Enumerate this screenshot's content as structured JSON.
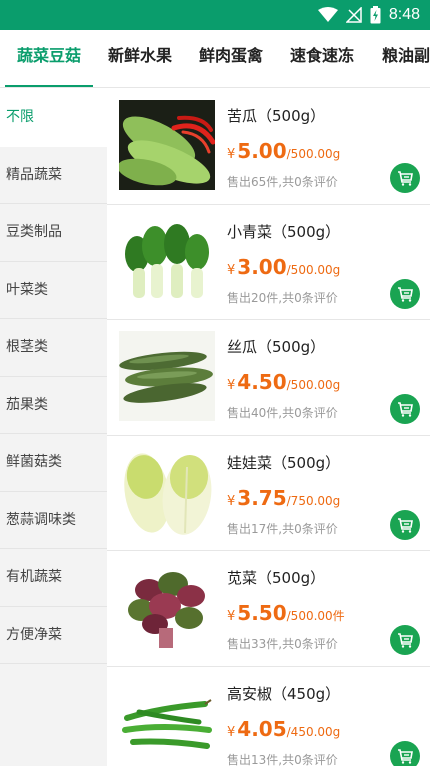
{
  "status_bar": {
    "time": "8:48"
  },
  "tabs": [
    {
      "label": "蔬菜豆菇"
    },
    {
      "label": "新鲜水果"
    },
    {
      "label": "鲜肉蛋禽"
    },
    {
      "label": "速食速冻"
    },
    {
      "label": "粮油副"
    }
  ],
  "sidebar": [
    {
      "label": "不限"
    },
    {
      "label": "精品蔬菜"
    },
    {
      "label": "豆类制品"
    },
    {
      "label": "叶菜类"
    },
    {
      "label": "根茎类"
    },
    {
      "label": "茄果类"
    },
    {
      "label": "鲜菌菇类"
    },
    {
      "label": "葱蒜调味类"
    },
    {
      "label": "有机蔬菜"
    },
    {
      "label": "方便净菜"
    }
  ],
  "products": [
    {
      "name": "苦瓜（500g）",
      "currency": "¥",
      "price": "5.00",
      "unit": "/500.00g",
      "sales": "售出65件,共0条评价"
    },
    {
      "name": "小青菜（500g）",
      "currency": "¥",
      "price": "3.00",
      "unit": "/500.00g",
      "sales": "售出20件,共0条评价"
    },
    {
      "name": "丝瓜（500g）",
      "currency": "¥",
      "price": "4.50",
      "unit": "/500.00g",
      "sales": "售出40件,共0条评价"
    },
    {
      "name": "娃娃菜（500g）",
      "currency": "¥",
      "price": "3.75",
      "unit": "/750.00g",
      "sales": "售出17件,共0条评价"
    },
    {
      "name": "苋菜（500g）",
      "currency": "¥",
      "price": "5.50",
      "unit": "/500.00件",
      "sales": "售出33件,共0条评价"
    },
    {
      "name": "高安椒（450g）",
      "currency": "¥",
      "price": "4.05",
      "unit": "/450.00g",
      "sales": "售出13件,共0条评价"
    }
  ],
  "colors": {
    "brand": "#0a9d6c",
    "price": "#ee6a12",
    "cart": "#1aa452"
  },
  "icons": {
    "cart": "cart-add-icon",
    "wifi": "wifi-icon",
    "signal": "signal-off-icon",
    "battery": "battery-charging-icon"
  }
}
